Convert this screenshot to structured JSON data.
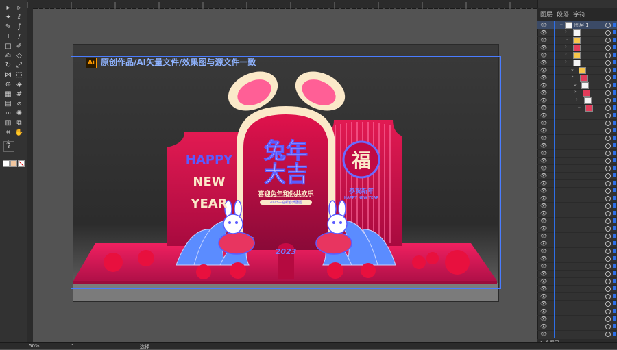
{
  "tools": {
    "items": [
      {
        "name": "selection-tool",
        "glyph": "▸"
      },
      {
        "name": "direct-selection-tool",
        "glyph": "▹"
      },
      {
        "name": "magic-wand-tool",
        "glyph": "✦"
      },
      {
        "name": "lasso-tool",
        "glyph": "ℓ"
      },
      {
        "name": "pen-tool",
        "glyph": "✎"
      },
      {
        "name": "curvature-tool",
        "glyph": "∫"
      },
      {
        "name": "type-tool",
        "glyph": "T"
      },
      {
        "name": "line-tool",
        "glyph": "/"
      },
      {
        "name": "rectangle-tool",
        "glyph": "□"
      },
      {
        "name": "paintbrush-tool",
        "glyph": "✐"
      },
      {
        "name": "shaper-tool",
        "glyph": "✍"
      },
      {
        "name": "eraser-tool",
        "glyph": "◇"
      },
      {
        "name": "rotate-tool",
        "glyph": "↻"
      },
      {
        "name": "scale-tool",
        "glyph": "⤢"
      },
      {
        "name": "width-tool",
        "glyph": "⋈"
      },
      {
        "name": "free-transform-tool",
        "glyph": "⬚"
      },
      {
        "name": "shape-builder-tool",
        "glyph": "⊕"
      },
      {
        "name": "live-paint-tool",
        "glyph": "◈"
      },
      {
        "name": "perspective-grid-tool",
        "glyph": "▦"
      },
      {
        "name": "mesh-tool",
        "glyph": "#"
      },
      {
        "name": "gradient-tool",
        "glyph": "▤"
      },
      {
        "name": "eyedropper-tool",
        "glyph": "⌀"
      },
      {
        "name": "blend-tool",
        "glyph": "∞"
      },
      {
        "name": "symbol-sprayer-tool",
        "glyph": "✺"
      },
      {
        "name": "column-graph-tool",
        "glyph": "▥"
      },
      {
        "name": "artboard-tool",
        "glyph": "⧉"
      },
      {
        "name": "slice-tool",
        "glyph": "⌗"
      },
      {
        "name": "hand-tool",
        "glyph": "✋"
      },
      {
        "name": "zoom-tool",
        "glyph": "⌕"
      }
    ],
    "help_glyph": "?"
  },
  "artboard": {
    "watermark_badge": "Ai",
    "watermark_text": "原创作品/AI矢量文件/效果图与源文件一致"
  },
  "design": {
    "left_panel_line1": "HAPPY",
    "left_panel_line2": "NEW",
    "left_panel_line3": "YEAR",
    "center_title_1": "兔年",
    "center_title_2": "大吉",
    "center_subtitle": "喜迎兔年和你共欢乐",
    "center_small": "2023—迎新春贺团圆",
    "right_fu": "福",
    "right_line1": "恭贺新年",
    "right_line2": "HAPPY NEW YEAR",
    "year_mark": "2023",
    "colors": {
      "primary_red": "#e01a4f",
      "deep_red": "#a0083a",
      "cream": "#fbe9c9",
      "pink": "#ff6fa0",
      "blue": "#5b5bff",
      "floor": "#d01048"
    }
  },
  "panel": {
    "tab_layers": "图层",
    "tab_paragraph": "段落",
    "tab_character": "字符",
    "layer1_name": "图层 1",
    "footer_count": "1 个图层"
  },
  "status": {
    "zoom": "50%",
    "page": "1",
    "mode": "选择"
  }
}
